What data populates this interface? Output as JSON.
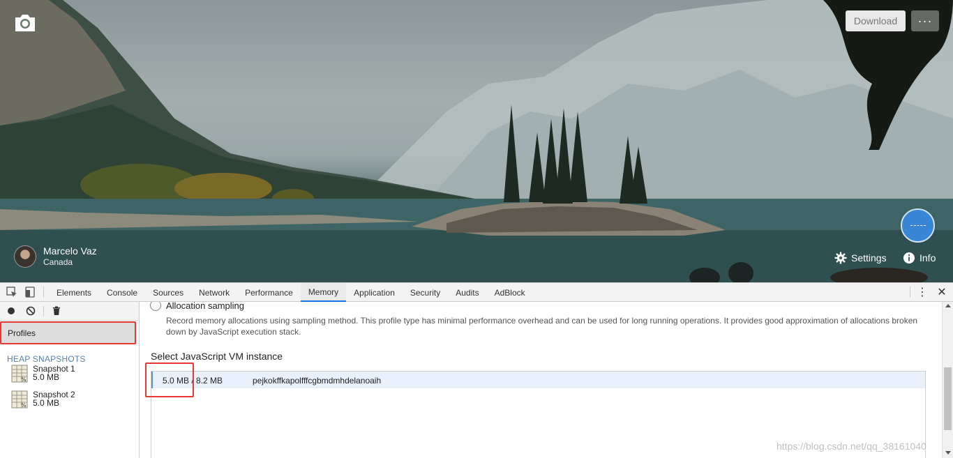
{
  "hero": {
    "download_label": "Download",
    "more_label": "···",
    "author_name": "Marcelo Vaz",
    "author_location": "Canada",
    "settings_label": "Settings",
    "info_label": "Info"
  },
  "devtools": {
    "tabs": [
      {
        "label": "Elements"
      },
      {
        "label": "Console"
      },
      {
        "label": "Sources"
      },
      {
        "label": "Network"
      },
      {
        "label": "Performance"
      },
      {
        "label": "Memory"
      },
      {
        "label": "Application"
      },
      {
        "label": "Security"
      },
      {
        "label": "Audits"
      },
      {
        "label": "AdBlock"
      }
    ],
    "active_tab": "Memory",
    "sidebar": {
      "profiles_label": "Profiles",
      "heap_header": "HEAP SNAPSHOTS",
      "snapshots": [
        {
          "name": "Snapshot 1",
          "size": "5.0 MB"
        },
        {
          "name": "Snapshot 2",
          "size": "5.0 MB"
        }
      ]
    },
    "main": {
      "radio_label": "Allocation sampling",
      "description": "Record memory allocations using sampling method. This profile type has minimal performance overhead and can be used for long running operations. It provides good approximation of allocations broken down by JavaScript execution stack.",
      "vm_title": "Select JavaScript VM instance",
      "vm_instance": {
        "memory": "5.0 MB / 8.2 MB",
        "id": "pejkokffkapolfffcgbmdmhdelanoaih"
      }
    },
    "watermark": "https://blog.csdn.net/qq_38161040"
  },
  "colors": {
    "highlight_red": "#e53935",
    "active_tab_underline": "#1a73e8",
    "clock_blue": "#3a86d6"
  }
}
